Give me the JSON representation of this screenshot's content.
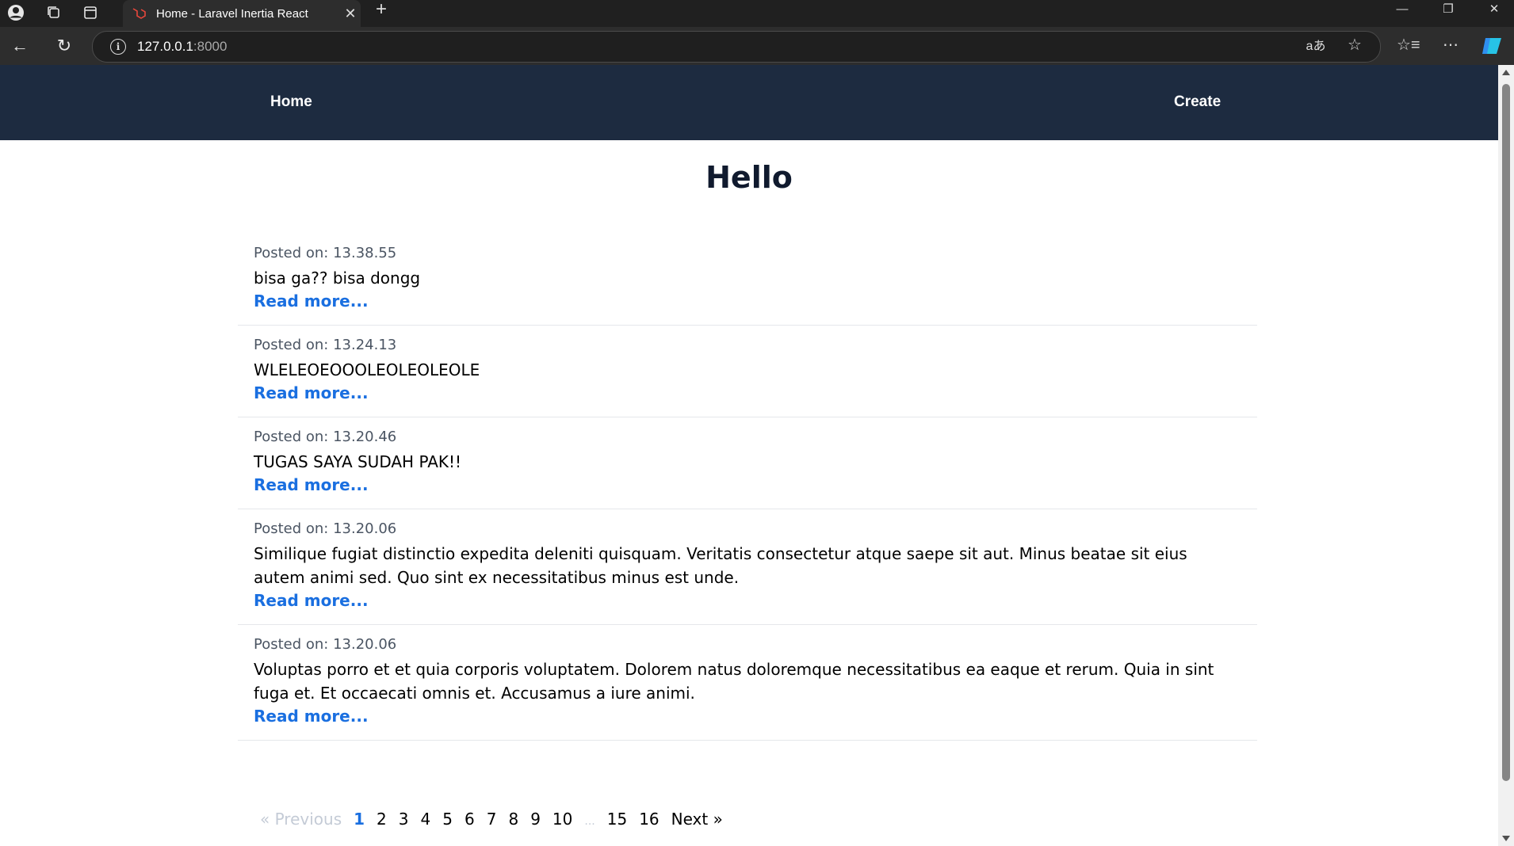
{
  "browser": {
    "tab_title": "Home - Laravel Inertia React",
    "url_host": "127.0.0.1",
    "url_port": ":8000",
    "icons": [
      "profile-icon",
      "workspaces-icon",
      "tab-actions-icon",
      "laravel-favicon",
      "close-icon",
      "new-tab-icon",
      "minimize-icon",
      "restore-icon",
      "window-close-icon",
      "back-icon",
      "refresh-icon",
      "site-info-icon",
      "read-aloud-icon",
      "favorite-star-icon",
      "favorites-icon",
      "more-icon",
      "copilot-icon"
    ]
  },
  "nav": {
    "home_label": "Home",
    "create_label": "Create"
  },
  "page": {
    "title": "Hello"
  },
  "posts": [
    {
      "meta": "Posted on: 13.38.55",
      "body": "bisa ga?? bisa dongg",
      "more": "Read more..."
    },
    {
      "meta": "Posted on: 13.24.13",
      "body": "WLELEOEOOOLEOLEOLEOLE",
      "more": "Read more..."
    },
    {
      "meta": "Posted on: 13.20.46",
      "body": "TUGAS SAYA SUDAH PAK!!",
      "more": "Read more..."
    },
    {
      "meta": "Posted on: 13.20.06",
      "body": "Similique fugiat distinctio expedita deleniti quisquam. Veritatis consectetur atque saepe sit aut. Minus beatae sit eius autem animi sed. Quo sint ex necessitatibus minus est unde.",
      "more": "Read more..."
    },
    {
      "meta": "Posted on: 13.20.06",
      "body": "Voluptas porro et et quia corporis voluptatem. Dolorem natus doloremque necessitatibus ea eaque et rerum. Quia in sint fuga et. Et occaecati omnis et. Accusamus a iure animi.",
      "more": "Read more..."
    }
  ],
  "pagination": {
    "previous": "« Previous",
    "pages": [
      "1",
      "2",
      "3",
      "4",
      "5",
      "6",
      "7",
      "8",
      "9",
      "10"
    ],
    "active_page": "1",
    "ellipsis": "...",
    "last_pages": [
      "15",
      "16"
    ],
    "next": "Next »"
  },
  "colors": {
    "nav_bg": "#1d2b40",
    "link_blue": "#1a6fe0",
    "title_color": "#101a2e"
  }
}
